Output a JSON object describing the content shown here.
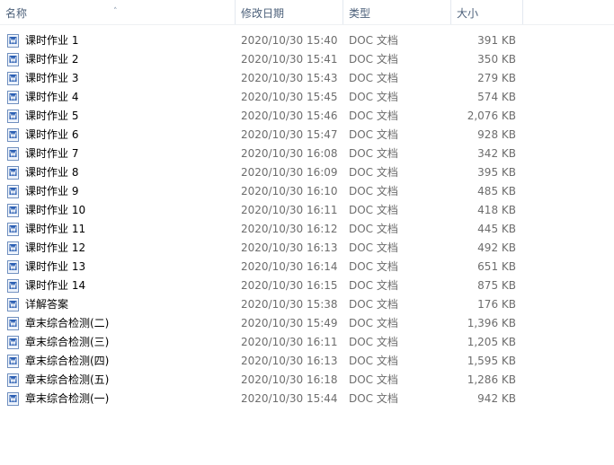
{
  "columns": {
    "name": "名称",
    "date": "修改日期",
    "type": "类型",
    "size": "大小"
  },
  "sort_icon": "sort-ascending-arrow",
  "file_icon": "word-document-icon",
  "files": [
    {
      "name": "课时作业 1",
      "date": "2020/10/30 15:40",
      "type": "DOC 文档",
      "size": "391 KB"
    },
    {
      "name": "课时作业 2",
      "date": "2020/10/30 15:41",
      "type": "DOC 文档",
      "size": "350 KB"
    },
    {
      "name": "课时作业 3",
      "date": "2020/10/30 15:43",
      "type": "DOC 文档",
      "size": "279 KB"
    },
    {
      "name": "课时作业 4",
      "date": "2020/10/30 15:45",
      "type": "DOC 文档",
      "size": "574 KB"
    },
    {
      "name": "课时作业 5",
      "date": "2020/10/30 15:46",
      "type": "DOC 文档",
      "size": "2,076 KB"
    },
    {
      "name": "课时作业 6",
      "date": "2020/10/30 15:47",
      "type": "DOC 文档",
      "size": "928 KB"
    },
    {
      "name": "课时作业 7",
      "date": "2020/10/30 16:08",
      "type": "DOC 文档",
      "size": "342 KB"
    },
    {
      "name": "课时作业 8",
      "date": "2020/10/30 16:09",
      "type": "DOC 文档",
      "size": "395 KB"
    },
    {
      "name": "课时作业 9",
      "date": "2020/10/30 16:10",
      "type": "DOC 文档",
      "size": "485 KB"
    },
    {
      "name": "课时作业 10",
      "date": "2020/10/30 16:11",
      "type": "DOC 文档",
      "size": "418 KB"
    },
    {
      "name": "课时作业 11",
      "date": "2020/10/30 16:12",
      "type": "DOC 文档",
      "size": "445 KB"
    },
    {
      "name": "课时作业 12",
      "date": "2020/10/30 16:13",
      "type": "DOC 文档",
      "size": "492 KB"
    },
    {
      "name": "课时作业 13",
      "date": "2020/10/30 16:14",
      "type": "DOC 文档",
      "size": "651 KB"
    },
    {
      "name": "课时作业 14",
      "date": "2020/10/30 16:15",
      "type": "DOC 文档",
      "size": "875 KB"
    },
    {
      "name": "详解答案",
      "date": "2020/10/30 15:38",
      "type": "DOC 文档",
      "size": "176 KB"
    },
    {
      "name": "章末综合检测(二)",
      "date": "2020/10/30 15:49",
      "type": "DOC 文档",
      "size": "1,396 KB"
    },
    {
      "name": "章末综合检测(三)",
      "date": "2020/10/30 16:11",
      "type": "DOC 文档",
      "size": "1,205 KB"
    },
    {
      "name": "章末综合检测(四)",
      "date": "2020/10/30 16:13",
      "type": "DOC 文档",
      "size": "1,595 KB"
    },
    {
      "name": "章末综合检测(五)",
      "date": "2020/10/30 16:18",
      "type": "DOC 文档",
      "size": "1,286 KB"
    },
    {
      "name": "章末综合检测(一)",
      "date": "2020/10/30 15:44",
      "type": "DOC 文档",
      "size": "942 KB"
    }
  ]
}
